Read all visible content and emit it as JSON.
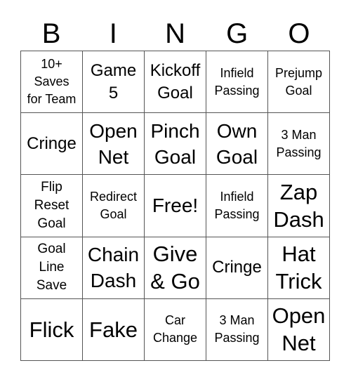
{
  "header": [
    "B",
    "I",
    "N",
    "G",
    "O"
  ],
  "cells": [
    [
      {
        "lines": [
          "10+",
          "Saves",
          "for Team"
        ],
        "size": "s1"
      },
      {
        "lines": [
          "Game",
          "5"
        ],
        "size": "s3"
      },
      {
        "lines": [
          "Kickoff",
          "Goal"
        ],
        "size": "s3"
      },
      {
        "lines": [
          "Infield",
          "Passing"
        ],
        "size": "s1"
      },
      {
        "lines": [
          "Prejump",
          "Goal"
        ],
        "size": "s1"
      }
    ],
    [
      {
        "lines": [
          "Cringe"
        ],
        "size": "s3"
      },
      {
        "lines": [
          "Open",
          "Net"
        ],
        "size": "s4"
      },
      {
        "lines": [
          "Pinch",
          "Goal"
        ],
        "size": "s4"
      },
      {
        "lines": [
          "Own",
          "Goal"
        ],
        "size": "s4"
      },
      {
        "lines": [
          "3 Man",
          "Passing"
        ],
        "size": "s1"
      }
    ],
    [
      {
        "lines": [
          "Flip",
          "Reset",
          "Goal"
        ],
        "size": "s2"
      },
      {
        "lines": [
          "Redirect",
          "Goal"
        ],
        "size": "s1"
      },
      {
        "lines": [
          "Free!"
        ],
        "size": "s4"
      },
      {
        "lines": [
          "Infield",
          "Passing"
        ],
        "size": "s1"
      },
      {
        "lines": [
          "Zap",
          "Dash"
        ],
        "size": "s5"
      }
    ],
    [
      {
        "lines": [
          "Goal",
          "Line",
          "Save"
        ],
        "size": "s2"
      },
      {
        "lines": [
          "Chain",
          "Dash"
        ],
        "size": "s4"
      },
      {
        "lines": [
          "Give",
          "& Go"
        ],
        "size": "s5"
      },
      {
        "lines": [
          "Cringe"
        ],
        "size": "s3"
      },
      {
        "lines": [
          "Hat",
          "Trick"
        ],
        "size": "s5"
      }
    ],
    [
      {
        "lines": [
          "Flick"
        ],
        "size": "s5"
      },
      {
        "lines": [
          "Fake"
        ],
        "size": "s5"
      },
      {
        "lines": [
          "Car",
          "Change"
        ],
        "size": "s1"
      },
      {
        "lines": [
          "3 Man",
          "Passing"
        ],
        "size": "s1"
      },
      {
        "lines": [
          "Open",
          "Net"
        ],
        "size": "s5"
      }
    ]
  ]
}
